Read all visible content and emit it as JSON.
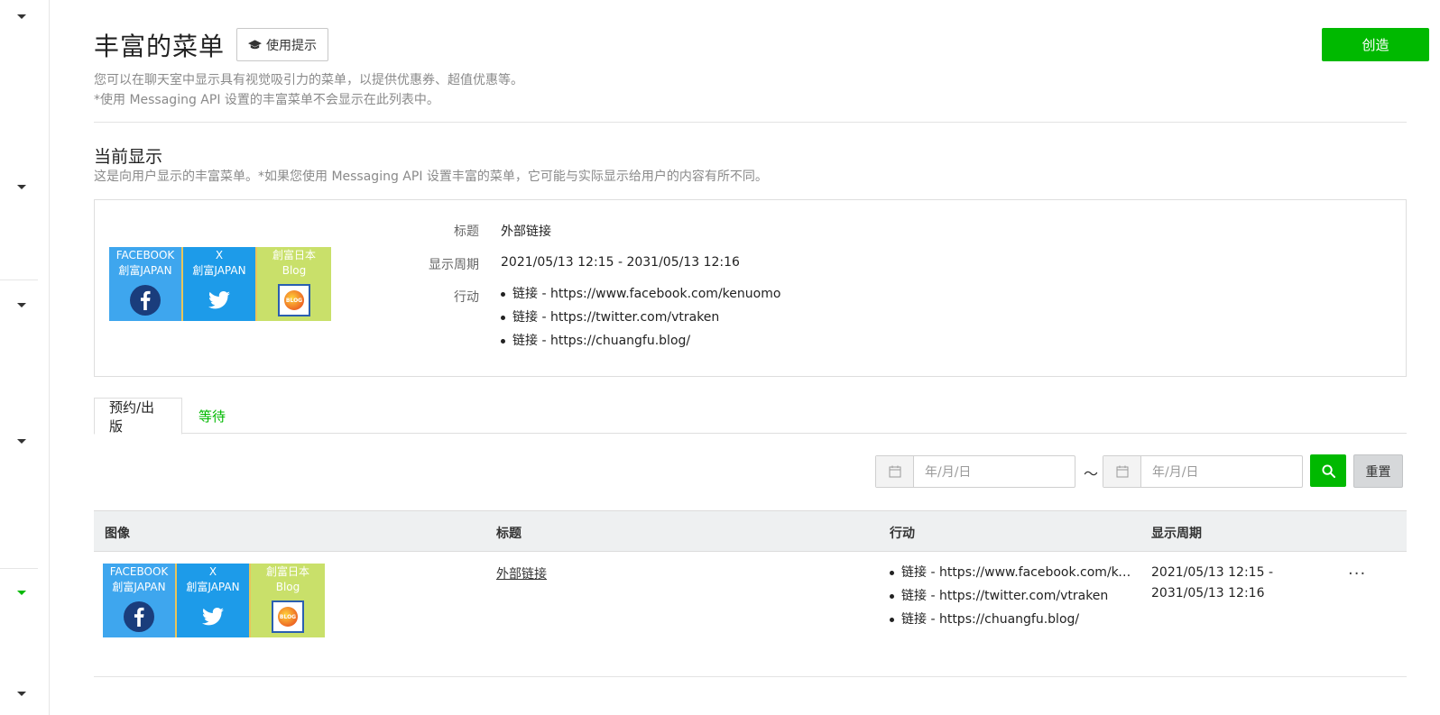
{
  "header": {
    "title": "丰富的菜单",
    "tips_label": "使用提示",
    "create_label": "创造",
    "desc1": "您可以在聊天室中显示具有视觉吸引力的菜单，以提供优惠券、超值优惠等。",
    "desc2": "*使用 Messaging API 设置的丰富菜单不会显示在此列表中。"
  },
  "current": {
    "title": "当前显示",
    "desc": "这是向用户显示的丰富菜单。*如果您使用 Messaging API 设置丰富的菜单，它可能与实际显示给用户的内容有所不同。",
    "title_label": "标题",
    "title_value": "外部链接",
    "period_label": "显示周期",
    "period_value": "2021/05/13 12:15 - 2031/05/13 12:16",
    "actions_label": "行动",
    "actions": [
      "链接 - https://www.facebook.com/kenuomo",
      "链接 - https://twitter.com/vtraken",
      "链接 - https://chuangfu.blog/"
    ]
  },
  "richmenu_tiles": {
    "fb_line1": "FACEBOOK",
    "fb_line2": "創富JAPAN",
    "x_line1": "X",
    "x_line2": "創富JAPAN",
    "blog_line1": "創富日本",
    "blog_line2": "Blog",
    "blog_badge": "BLOG"
  },
  "tabs": [
    {
      "label": "预约/出版"
    },
    {
      "label": "等待"
    }
  ],
  "filter": {
    "date_placeholder": "年/月/日",
    "tilde": "～",
    "reset_label": "重置"
  },
  "table": {
    "headers": [
      "图像",
      "标题",
      "行动",
      "显示周期"
    ],
    "rows": [
      {
        "title": "外部链接",
        "actions": [
          "链接 - https://www.facebook.com/kenuomo",
          "链接 - https://twitter.com/vtraken",
          "链接 - https://chuangfu.blog/"
        ],
        "period_line1": "2021/05/13 12:15 -",
        "period_line2": "2031/05/13 12:16",
        "more": "···"
      }
    ]
  },
  "colors": {
    "accent": "#00b900",
    "facebook_tile": "#3ea6ee",
    "x_tile": "#1d9be9",
    "blog_tile": "#c9e06a"
  }
}
